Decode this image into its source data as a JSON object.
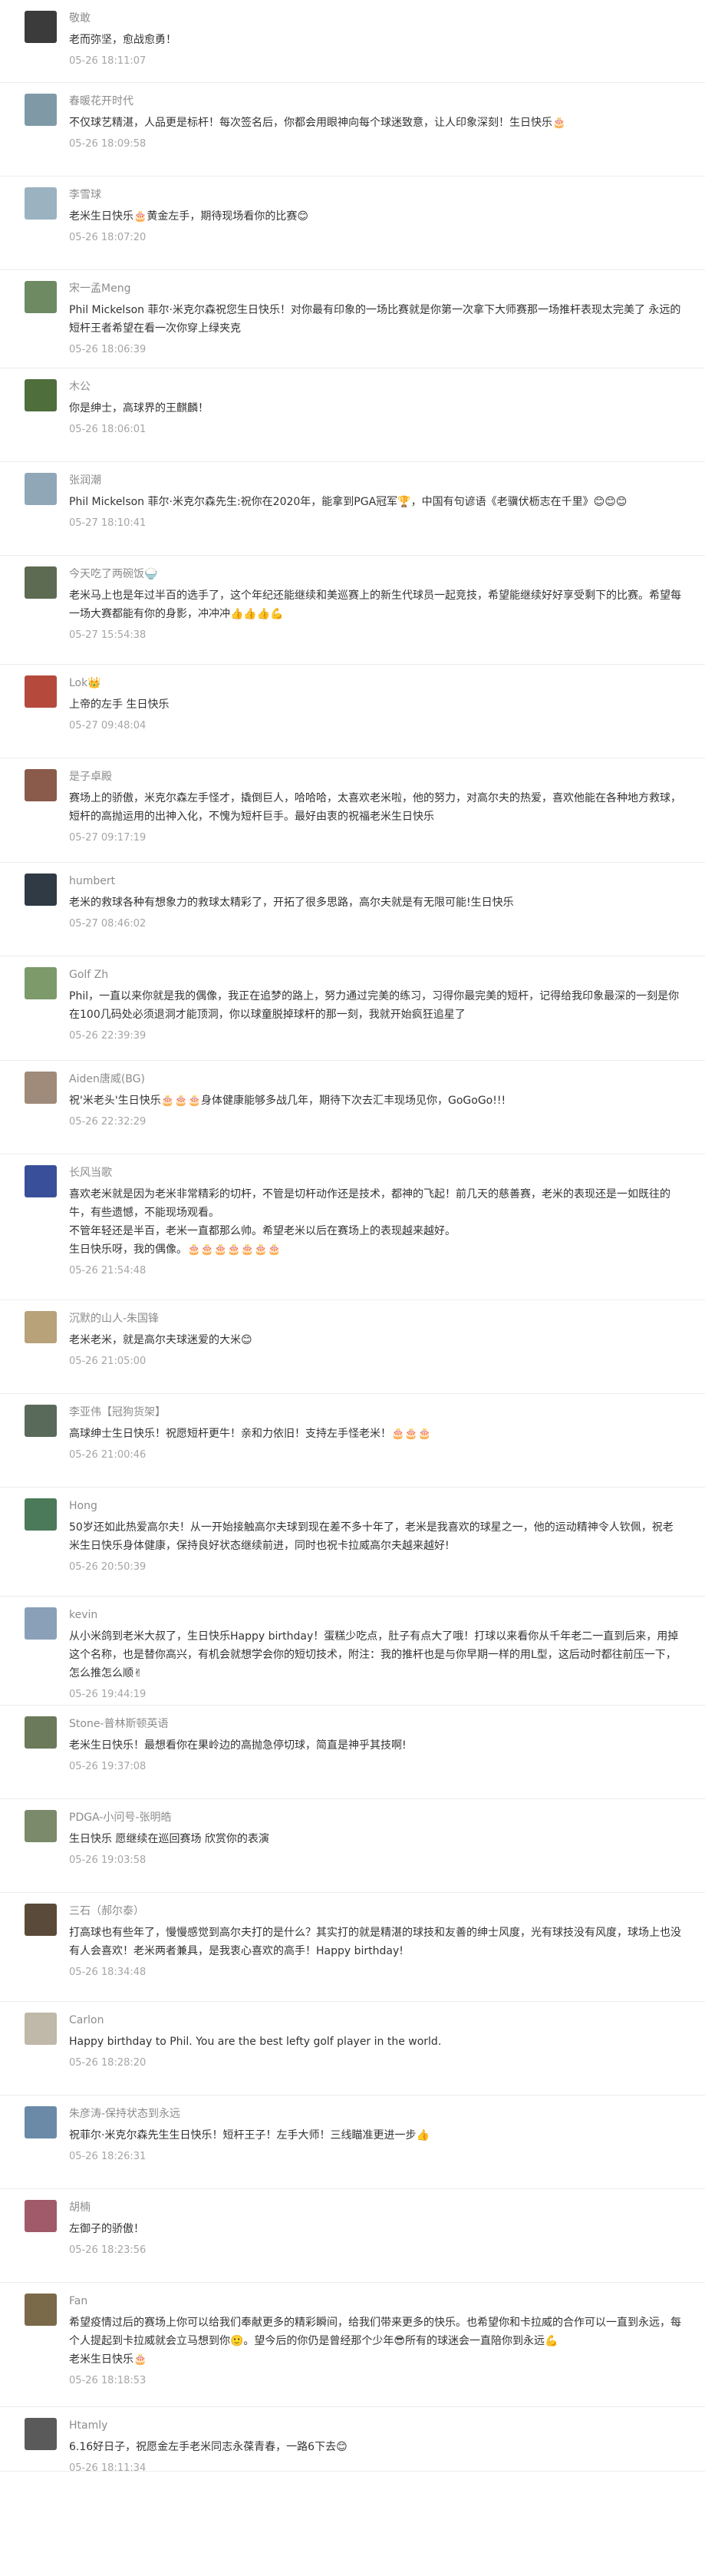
{
  "comments": [
    {
      "user": "敬敢",
      "text": "老而弥坚，愈战愈勇！",
      "time": "05-26 18:11:07",
      "avatar_color": "#3b3b3b"
    },
    {
      "user": "春暖花开时代",
      "text": "不仅球艺精湛，人品更是标杆！每次签名后，你都会用眼神向每个球迷致意，让人印象深刻！生日快乐🎂",
      "time": "05-26 18:09:58",
      "avatar_color": "#7f9aa6"
    },
    {
      "user": "李雪球",
      "text": "老米生日快乐🎂黄金左手，期待现场看你的比赛😊",
      "time": "05-26 18:07:20",
      "avatar_color": "#9bb2c0"
    },
    {
      "user": "宋一孟Meng",
      "text": "Phil Mickelson 菲尔·米克尔森祝您生日快乐！对你最有印象的一场比赛就是你第一次拿下大师赛那一场推杆表现太完美了 永远的短杆王者希望在看一次你穿上绿夹克",
      "time": "05-26 18:06:39",
      "avatar_color": "#6d8a63"
    },
    {
      "user": "木公",
      "text": "你是绅士，高球界的王麒麟！",
      "time": "05-26 18:06:01",
      "avatar_color": "#4e6e3c"
    },
    {
      "user": "张润潮",
      "text": "Phil Mickelson 菲尔·米克尔森先生:祝你在2020年，能拿到PGA冠军🏆，中国有句谚语《老骥伏枥志在千里》😊😊😊",
      "time": "05-27 18:10:41",
      "avatar_color": "#90a7b8"
    },
    {
      "user": "今天吃了两碗饭🍚",
      "text": "老米马上也是年过半百的选手了，这个年纪还能继续和美巡赛上的新生代球员一起竞技，希望能继续好好享受剩下的比赛。希望每一场大赛都能有你的身影，冲冲冲👍👍👍💪",
      "time": "05-27 15:54:38",
      "avatar_color": "#5d6b52"
    },
    {
      "user": "Lok👑",
      "text": "上帝的左手 生日快乐",
      "time": "05-27 09:48:04",
      "avatar_color": "#b54a3c"
    },
    {
      "user": "是子卓殿",
      "text": "赛场上的骄傲，米克尔森左手怪才，撬倒巨人，哈哈哈，太喜欢老米啦，他的努力，对高尔夫的热爱，喜欢他能在各种地方救球，短杆的高抛运用的出神入化，不愧为短杆巨手。最好由衷的祝福老米生日快乐",
      "time": "05-27 09:17:19",
      "avatar_color": "#8a5a4a"
    },
    {
      "user": "humbert",
      "text": "老米的救球各种有想象力的救球太精彩了，开拓了很多思路，高尔夫就是有无限可能!生日快乐",
      "time": "05-27 08:46:02",
      "avatar_color": "#2f3a45"
    },
    {
      "user": "Golf Zh",
      "text": "Phil，一直以来你就是我的偶像，我正在追梦的路上，努力通过完美的练习，习得你最完美的短杆，记得给我印象最深的一刻是你在100几码处必须退洞才能顶洞，你以球童脱掉球杆的那一刻，我就开始疯狂追星了",
      "time": "05-26 22:39:39",
      "avatar_color": "#7c9a6a"
    },
    {
      "user": "Aiden唐威(BG)",
      "text": "祝'米老头'生日快乐🎂🎂🎂身体健康能够多战几年，期待下次去汇丰现场见你，GoGoGo!!!",
      "time": "05-26 22:32:29",
      "avatar_color": "#a08a7a"
    },
    {
      "user": "长风当歌",
      "text": "喜欢老米就是因为老米非常精彩的切杆，不管是切杆动作还是技术，都神的飞起！前几天的慈善赛，老米的表现还是一如既往的牛，有些遗憾，不能现场观看。\n不管年轻还是半百，老米一直都那么帅。希望老米以后在赛场上的表现越来越好。\n生日快乐呀，我的偶像。🎂🎂🎂🎂🎂🎂🎂",
      "time": "05-26 21:54:48",
      "avatar_color": "#3a4f9a"
    },
    {
      "user": "沉默的山人-朱国锋",
      "text": "老米老米，就是高尔夫球迷爱的大米😊",
      "time": "05-26 21:05:00",
      "avatar_color": "#b8a27a"
    },
    {
      "user": "李亚伟【冠狗货架】",
      "text": "高球绅士生日快乐！祝愿短杆更牛！亲和力依旧！支持左手怪老米！🎂🎂🎂",
      "time": "05-26 21:00:46",
      "avatar_color": "#5a6a5a"
    },
    {
      "user": "Hong",
      "text": "50岁还如此热爱高尔夫！从一开始接触高尔夫球到现在差不多十年了，老米是我喜欢的球星之一，他的运动精神令人钦佩，祝老米生日快乐身体健康，保持良好状态继续前进，同时也祝卡拉威高尔夫越来越好!",
      "time": "05-26 20:50:39",
      "avatar_color": "#4a7a5a"
    },
    {
      "user": "kevin",
      "text": "从小米鸽到老米大叔了，生日快乐Happy birthday！蛋糕少吃点，肚子有点大了哦！打球以来看你从千年老二一直到后来，用掉这个名称，也是替你高兴，有机会就想学会你的短切技术，附注：我的推杆也是与你早期一样的用L型，这后动时都往前压一下，怎么推怎么顺✌",
      "time": "05-26 19:44:19",
      "avatar_color": "#8aa0b8"
    },
    {
      "user": "Stone-普林斯顿英语",
      "text": "老米生日快乐！最想看你在果岭边的高抛急停切球，简直是神乎其技啊!",
      "time": "05-26 19:37:08",
      "avatar_color": "#6a7a5a"
    },
    {
      "user": "PDGA-小问号-张明皓",
      "text": "生日快乐 愿继续在巡回赛场 欣赏你的表演",
      "time": "05-26 19:03:58",
      "avatar_color": "#7a8a6a"
    },
    {
      "user": "三石（郝尔泰）",
      "text": "打高球也有些年了，慢慢感觉到高尔夫打的是什么？其实打的就是精湛的球技和友善的绅士风度，光有球技没有风度，球场上也没有人会喜欢！老米两者兼具，是我衷心喜欢的高手！Happy birthday!",
      "time": "05-26 18:34:48",
      "avatar_color": "#5a4a3a"
    },
    {
      "user": "Carlon",
      "text": "Happy birthday to Phil. You are the best lefty golf player in the world.",
      "time": "05-26 18:28:20",
      "avatar_color": "#c0b8a8"
    },
    {
      "user": "朱彦涛-保持状态到永远",
      "text": "祝菲尔·米克尔森先生生日快乐！短杆王子！左手大师！三线瞄准更进一步👍",
      "time": "05-26 18:26:31",
      "avatar_color": "#6a8aa8"
    },
    {
      "user": "胡楠",
      "text": "左御子的骄傲！",
      "time": "05-26 18:23:56",
      "avatar_color": "#a05a6a"
    },
    {
      "user": "Fan",
      "text": "希望疫情过后的赛场上你可以给我们奉献更多的精彩瞬间，给我们带来更多的快乐。也希望你和卡拉威的合作可以一直到永远，每个人提起到卡拉威就会立马想到你🙂。望今后的你仍是曾经那个少年😎所有的球迷会一直陪你到永远💪\n老米生日快乐🎂",
      "time": "05-26 18:18:53",
      "avatar_color": "#7a6a4a"
    },
    {
      "user": "Htamly",
      "text": "6.16好日子，祝愿金左手老米同志永葆青春，一路6下去😊",
      "time": "05-26 18:11:34",
      "avatar_color": "#5a5a5a"
    }
  ]
}
